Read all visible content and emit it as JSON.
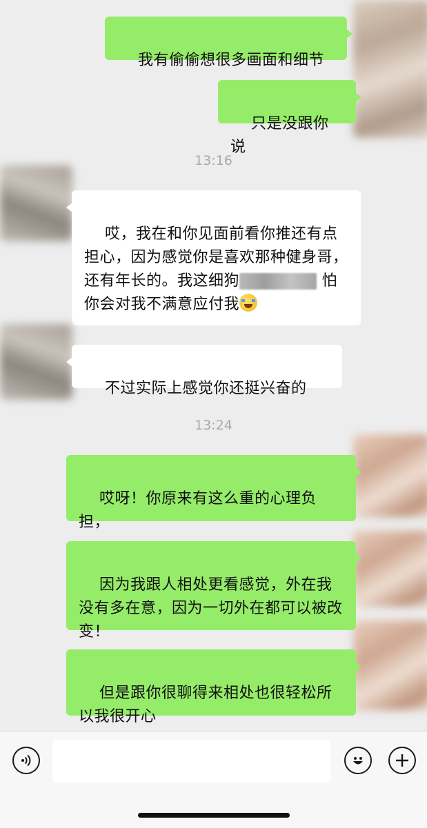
{
  "messages": [
    {
      "side": "sent",
      "text": "我有偷偷想很多画面和细节"
    },
    {
      "side": "sent",
      "text": "只是没跟你说"
    },
    {
      "side": "received",
      "text_before_redaction": "哎，我在和你见面前看你推还有点担心，因为感觉你是喜欢那种健身哥，还有年长的。我这细狗",
      "text_after_redaction": " 怕你会对我不满意应付我"
    },
    {
      "side": "received",
      "text": "不过实际上感觉你还挺兴奋的"
    },
    {
      "side": "sent",
      "text": "哎呀！你原来有这么重的心理负担，"
    },
    {
      "side": "sent",
      "text": "因为我跟人相处更看感觉，外在我没有多在意，因为一切外在都可以被改变！"
    },
    {
      "side": "sent",
      "text": "但是跟你很聊得来相处也很轻松所以我很开心"
    }
  ],
  "timestamps": [
    "13:16",
    "13:24"
  ],
  "input": {
    "value": "",
    "placeholder": ""
  },
  "icons": {
    "voice": "voice-icon",
    "emoji": "emoji-icon",
    "more": "plus-icon"
  },
  "colors": {
    "background": "#ededed",
    "sent_bubble": "#95ec69",
    "received_bubble": "#ffffff",
    "timestamp": "#a8a8a8"
  }
}
